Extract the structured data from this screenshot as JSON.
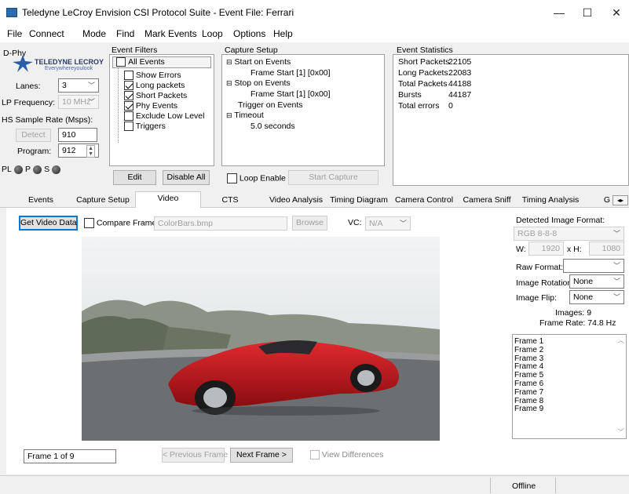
{
  "window": {
    "title": "Teledyne LeCroy Envision CSI Protocol Suite - Event File: Ferrari",
    "minimize": "—",
    "maximize": "☐",
    "close": "✕"
  },
  "menu": [
    "File",
    "Connect",
    "Mode",
    "Find",
    "Mark Events",
    "Loop",
    "Options",
    "Help"
  ],
  "dphy": {
    "group_label": "D-Phy",
    "logo_name": "TELEDYNE LECROY",
    "logo_tagline": "Everywhereyoulook",
    "lanes_label": "Lanes:",
    "lanes_value": "3",
    "lp_label": "LP Frequency:",
    "lp_value": "10 MHz",
    "hs_label": "HS Sample Rate (Msps):",
    "detect_label": "Detect",
    "detect_value": "910",
    "program_label": "Program:",
    "program_value": "912",
    "led_pl": "PL",
    "led_p": "P",
    "led_s": "S"
  },
  "event_filters": {
    "title": "Event Filters",
    "all_events": "All Events",
    "items": [
      {
        "label": "Show Errors",
        "checked": false
      },
      {
        "label": "Long packets",
        "checked": true
      },
      {
        "label": "Short Packets",
        "checked": true
      },
      {
        "label": "Phy Events",
        "checked": true
      },
      {
        "label": "Exclude Low Level",
        "checked": false
      },
      {
        "label": "Triggers",
        "checked": false
      }
    ],
    "edit": "Edit",
    "disable_all": "Disable All"
  },
  "capture_setup": {
    "title": "Capture Setup",
    "start_on": "Start on Events",
    "start_frame": "Frame Start [1] [0x00]",
    "stop_on": "Stop on Events",
    "stop_frame": "Frame Start [1] [0x00]",
    "trigger": "Trigger on Events",
    "timeout": "Timeout",
    "timeout_value": "5.0 seconds",
    "loop_enable": "Loop Enable",
    "start_capture": "Start Capture"
  },
  "event_statistics": {
    "title": "Event Statistics",
    "rows": [
      {
        "label": "Short Packets",
        "value": "22105"
      },
      {
        "label": "Long Packets",
        "value": "22083"
      },
      {
        "label": "Total Packets",
        "value": "44188"
      },
      {
        "label": "Bursts",
        "value": "44187"
      },
      {
        "label": "Total errors",
        "value": "0"
      }
    ]
  },
  "tabs": [
    "Events",
    "Capture Setup",
    "Video",
    "CTS",
    "Video Analysis",
    "Timing Diagram",
    "Camera Control",
    "Camera Sniff",
    "Timing Analysis",
    "G"
  ],
  "selected_tab": "Video",
  "video": {
    "get_video_data": "Get Video Data",
    "compare_frames": "Compare Frames",
    "compare_file": "ColorBars.bmp",
    "browse": "Browse",
    "vc_label": "VC:",
    "vc_value": "N/A",
    "frame_status": "Frame 1 of 9",
    "prev_frame": "< Previous Frame",
    "next_frame": "Next Frame >",
    "view_differences": "View Differences"
  },
  "image_info": {
    "detected_label": "Detected Image Format:",
    "detected_value": "RGB 8-8-8",
    "w_label": "W:",
    "w_value": "1920",
    "h_label": "x H:",
    "h_value": "1080",
    "raw_label": "Raw Format:",
    "raw_value": "",
    "rotation_label": "Image Rotation:",
    "rotation_value": "None",
    "flip_label": "Image Flip:",
    "flip_value": "None",
    "images": "Images: 9",
    "frame_rate": "Frame Rate: 74.8 Hz",
    "frames": [
      "Frame 1",
      "Frame 2",
      "Frame 3",
      "Frame 4",
      "Frame 5",
      "Frame 6",
      "Frame 7",
      "Frame 8",
      "Frame 9"
    ]
  },
  "status": {
    "text": "Offline"
  },
  "colors": {
    "car": "#c0141a",
    "sky": "#e8ecef",
    "road": "#6c6f72",
    "focus_blue": "#0078d7"
  }
}
